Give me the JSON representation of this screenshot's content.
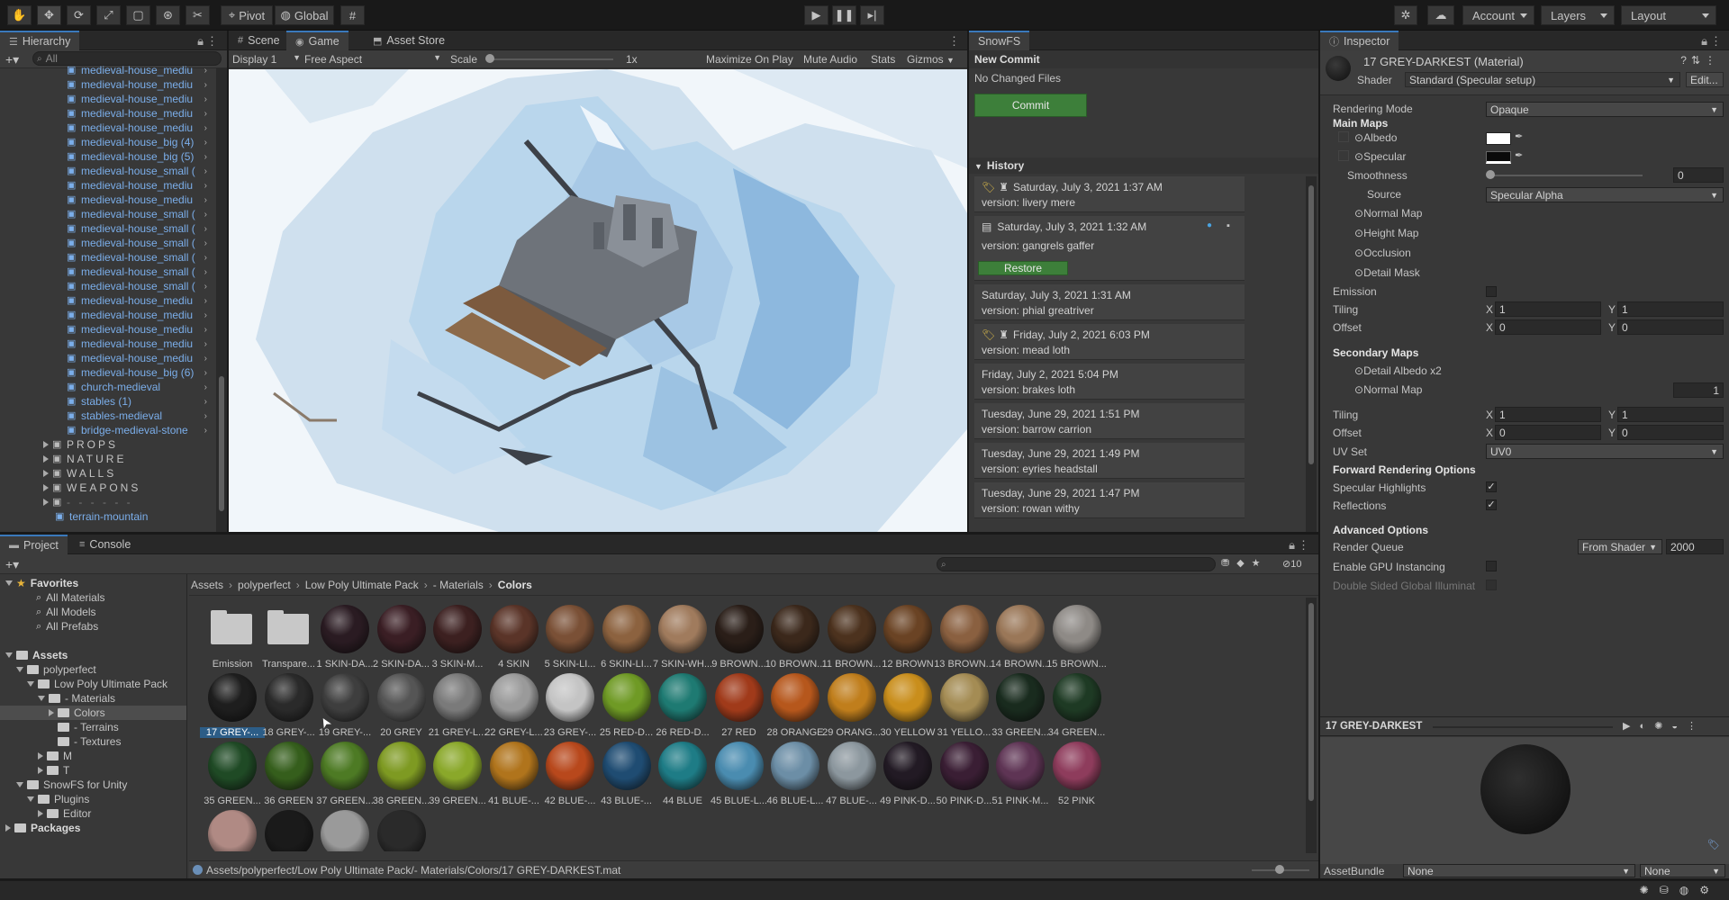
{
  "toolbar": {
    "pivot": "Pivot",
    "global": "Global",
    "account": "Account",
    "layers": "Layers",
    "layout": "Layout"
  },
  "hierarchy": {
    "tab": "Hierarchy",
    "search_placeholder": "All",
    "items": [
      "medieval-house_mediu",
      "medieval-house_mediu",
      "medieval-house_mediu",
      "medieval-house_mediu",
      "medieval-house_mediu",
      "medieval-house_big (4)",
      "medieval-house_big (5)",
      "medieval-house_small (",
      "medieval-house_mediu",
      "medieval-house_mediu",
      "medieval-house_small (",
      "medieval-house_small (",
      "medieval-house_small (",
      "medieval-house_small (",
      "medieval-house_small (",
      "medieval-house_small (",
      "medieval-house_mediu",
      "medieval-house_mediu",
      "medieval-house_mediu",
      "medieval-house_mediu",
      "medieval-house_mediu",
      "medieval-house_big (6)",
      "church-medieval",
      "stables (1)",
      "stables-medieval",
      "bridge-medieval-stone"
    ],
    "groups": [
      "PROPS",
      "NATURE",
      "WALLS",
      "WEAPONS",
      "- - - - - -"
    ],
    "terrain": "terrain-mountain"
  },
  "game": {
    "tabs": [
      "Scene",
      "Game",
      "Asset Store"
    ],
    "display": "Display 1",
    "aspect": "Free Aspect",
    "scale_label": "Scale",
    "scale_value": "1x",
    "maximize": "Maximize On Play",
    "mute": "Mute Audio",
    "stats": "Stats",
    "gizmos": "Gizmos"
  },
  "snowfs": {
    "tab": "SnowFS",
    "new_commit": "New Commit",
    "no_changes": "No Changed Files",
    "commit_button": "Commit",
    "history_title": "History",
    "restore_button": "Restore",
    "commits": [
      {
        "date": "Saturday, July 3, 2021  1:37 AM",
        "version": "version: livery mere"
      },
      {
        "date": "Saturday, July 3, 2021  1:32 AM",
        "version": "version: gangrels gaffer"
      },
      {
        "date": "Saturday, July 3, 2021  1:31 AM",
        "version": "version: phial greatriver"
      },
      {
        "date": "Friday, July 2, 2021   6:03 PM",
        "version": "version: mead loth"
      },
      {
        "date": "Friday, July 2, 2021   5:04 PM",
        "version": "version: brakes loth"
      },
      {
        "date": "Tuesday, June 29, 2021  1:51 PM",
        "version": "version: barrow carrion"
      },
      {
        "date": "Tuesday, June 29, 2021  1:49 PM",
        "version": "version: eyries headstall"
      },
      {
        "date": "Tuesday, June 29, 2021  1:47 PM",
        "version": "version: rowan withy"
      }
    ]
  },
  "inspector": {
    "tab": "Inspector",
    "title": "17 GREY-DARKEST (Material)",
    "shader_label": "Shader",
    "shader_value": "Standard (Specular setup)",
    "edit": "Edit...",
    "rendering_mode_label": "Rendering Mode",
    "rendering_mode": "Opaque",
    "main_maps": "Main Maps",
    "albedo": "Albedo",
    "specular": "Specular",
    "smoothness": "Smoothness",
    "smoothness_value": "0",
    "source": "Source",
    "source_value": "Specular Alpha",
    "normal_map": "Normal Map",
    "height_map": "Height Map",
    "occlusion": "Occlusion",
    "detail_mask": "Detail Mask",
    "emission": "Emission",
    "tiling": "Tiling",
    "offset": "Offset",
    "x": "X",
    "y": "Y",
    "one": "1",
    "zero": "0",
    "secondary_maps": "Secondary Maps",
    "detail_albedo": "Detail Albedo x2",
    "normal_map2": "Normal Map",
    "normal_value": "1",
    "uv_set": "UV Set",
    "uv_value": "UV0",
    "forward": "Forward Rendering Options",
    "spec_highlights": "Specular Highlights",
    "reflections": "Reflections",
    "advanced": "Advanced Options",
    "render_queue": "Render Queue",
    "from_shader": "From Shader",
    "queue_value": "2000",
    "gpu_instancing": "Enable GPU Instancing",
    "double_sided": "Double Sided Global Illuminat",
    "preview_title": "17 GREY-DARKEST",
    "asset_bundle": "AssetBundle",
    "none1": "None",
    "none2": "None"
  },
  "project": {
    "tabs": [
      "Project",
      "Console"
    ],
    "hidden_count": "10",
    "breadcrumb": [
      "Assets",
      "polyperfect",
      "Low Poly Ultimate Pack",
      "- Materials",
      "Colors"
    ],
    "tree": [
      {
        "label": "Favorites",
        "indent": 0,
        "fold": "open",
        "icon": "star",
        "bold": true
      },
      {
        "label": "All Materials",
        "indent": 2,
        "icon": "search"
      },
      {
        "label": "All Models",
        "indent": 2,
        "icon": "search"
      },
      {
        "label": "All Prefabs",
        "indent": 2,
        "icon": "search"
      },
      {
        "label": "",
        "indent": 0
      },
      {
        "label": "Assets",
        "indent": 0,
        "fold": "open",
        "icon": "folder",
        "bold": true
      },
      {
        "label": "polyperfect",
        "indent": 1,
        "fold": "open",
        "icon": "folder"
      },
      {
        "label": "Low Poly Ultimate Pack",
        "indent": 2,
        "fold": "open",
        "icon": "folder"
      },
      {
        "label": "- Materials",
        "indent": 3,
        "fold": "open",
        "icon": "folder"
      },
      {
        "label": "Colors",
        "indent": 4,
        "fold": "closed",
        "icon": "folder",
        "sel": true
      },
      {
        "label": "- Terrains",
        "indent": 4,
        "icon": "folder"
      },
      {
        "label": "- Textures",
        "indent": 4,
        "icon": "folder"
      },
      {
        "label": "M",
        "indent": 3,
        "fold": "closed",
        "icon": "folder"
      },
      {
        "label": "T",
        "indent": 3,
        "fold": "closed",
        "icon": "folder"
      },
      {
        "label": "SnowFS for Unity",
        "indent": 1,
        "fold": "open",
        "icon": "folder"
      },
      {
        "label": "Plugins",
        "indent": 2,
        "fold": "open",
        "icon": "folder"
      },
      {
        "label": "Editor",
        "indent": 3,
        "fold": "closed",
        "icon": "folder"
      },
      {
        "label": "Packages",
        "indent": 0,
        "fold": "closed",
        "icon": "folder",
        "bold": true
      }
    ],
    "assets": [
      {
        "name": "Emission",
        "folder": true
      },
      {
        "name": "Transpare...",
        "folder": true
      },
      {
        "name": "1 SKIN-DA...",
        "color": "#2a1b22"
      },
      {
        "name": "2 SKIN-DA...",
        "color": "#3a1e24"
      },
      {
        "name": "3 SKIN-M...",
        "color": "#3c2020"
      },
      {
        "name": "4 SKIN",
        "color": "#5a3428"
      },
      {
        "name": "5 SKIN-LI...",
        "color": "#7a5036"
      },
      {
        "name": "6 SKIN-LI...",
        "color": "#8c623f"
      },
      {
        "name": "7 SKIN-WH...",
        "color": "#a07b5d"
      },
      {
        "name": "9 BROWN...",
        "color": "#2a1e18"
      },
      {
        "name": "10 BROWN...",
        "color": "#3b281b"
      },
      {
        "name": "11 BROWN...",
        "color": "#4c321e"
      },
      {
        "name": "12 BROWN",
        "color": "#6a4324"
      },
      {
        "name": "13 BROWN...",
        "color": "#8a6040"
      },
      {
        "name": "14 BROWN...",
        "color": "#9a7758"
      },
      {
        "name": "15 BROWN...",
        "color": "#8e8a86"
      },
      {
        "name": "17 GREY-...",
        "color": "#1e1e1e",
        "sel": true
      },
      {
        "name": "18 GREY-...",
        "color": "#2a2a2a"
      },
      {
        "name": "19 GREY-...",
        "color": "#3e3e3e"
      },
      {
        "name": "20 GREY",
        "color": "#555555"
      },
      {
        "name": "21 GREY-L...",
        "color": "#7a7a7a"
      },
      {
        "name": "22 GREY-L...",
        "color": "#9a9a9a"
      },
      {
        "name": "23 GREY-...",
        "color": "#c4c4c4"
      },
      {
        "name": "25 RED-D...",
        "color": "#6f9a25"
      },
      {
        "name": "26 RED-D...",
        "color": "#1e7a72"
      },
      {
        "name": "27 RED",
        "color": "#a03a1a"
      },
      {
        "name": "28 ORANGE",
        "color": "#b6571c"
      },
      {
        "name": "29 ORANG...",
        "color": "#c07e1c"
      },
      {
        "name": "30 YELLOW",
        "color": "#c98e1c"
      },
      {
        "name": "31 YELLO...",
        "color": "#a48c54"
      },
      {
        "name": "33 GREEN...",
        "color": "#192b1e"
      },
      {
        "name": "34 GREEN...",
        "color": "#1e3a24"
      },
      {
        "name": "35 GREEN...",
        "color": "#1f4a25"
      },
      {
        "name": "36 GREEN",
        "color": "#355e1c"
      },
      {
        "name": "37 GREEN...",
        "color": "#4d7a24"
      },
      {
        "name": "38 GREEN...",
        "color": "#7e9a22"
      },
      {
        "name": "39 GREEN...",
        "color": "#8aa82a"
      },
      {
        "name": "41 BLUE-...",
        "color": "#b0741c"
      },
      {
        "name": "42 BLUE-...",
        "color": "#b8481c"
      },
      {
        "name": "43 BLUE-...",
        "color": "#1f4c72"
      },
      {
        "name": "44 BLUE",
        "color": "#1e7c86"
      },
      {
        "name": "45 BLUE-L...",
        "color": "#4a8cb0"
      },
      {
        "name": "46 BLUE-L...",
        "color": "#6c8ea6"
      },
      {
        "name": "47 BLUE-...",
        "color": "#8c979e"
      },
      {
        "name": "49 PINK-D...",
        "color": "#221a24"
      },
      {
        "name": "50 PINK-D...",
        "color": "#3a1e34"
      },
      {
        "name": "51 PINK-M...",
        "color": "#5e3454"
      },
      {
        "name": "52 PINK",
        "color": "#8e3c5c"
      }
    ],
    "path": "Assets/polyperfect/Low Poly Ultimate Pack/- Materials/Colors/17 GREY-DARKEST.mat"
  }
}
